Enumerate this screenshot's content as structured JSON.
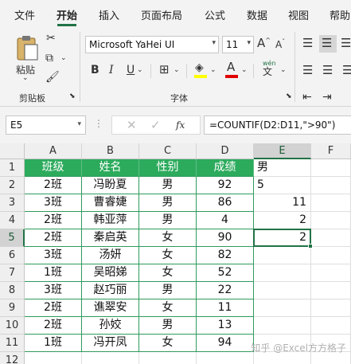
{
  "menu": {
    "tabs": [
      "文件",
      "开始",
      "插入",
      "页面布局",
      "公式",
      "数据",
      "视图",
      "帮助"
    ],
    "active": "开始"
  },
  "ribbon": {
    "clipboard_group": "剪贴板",
    "paste_label": "粘贴",
    "font_group": "字体",
    "font_name": "Microsoft YaHei UI",
    "font_size": "11",
    "bold": "B",
    "italic": "I",
    "underline": "U",
    "grow_font": "A",
    "shrink_font": "A",
    "font_color_letter": "A",
    "phonetic": "wén",
    "phonetic_char": "文",
    "accent_color": "#217346",
    "fill_color": "#ffff00",
    "font_color": "#e00000"
  },
  "formula_bar": {
    "name_box": "E5",
    "fx": "fx",
    "formula": "=COUNTIF(D2:D11,\">90\")"
  },
  "sheet": {
    "columns": [
      "A",
      "B",
      "C",
      "D",
      "E",
      "F"
    ],
    "rows": [
      "1",
      "2",
      "3",
      "4",
      "5",
      "6",
      "7",
      "8",
      "9",
      "10",
      "11",
      "12"
    ],
    "selected_cell": "E5",
    "table": {
      "headers": [
        "班级",
        "姓名",
        "性别",
        "成绩"
      ],
      "rows": [
        [
          "2班",
          "冯盼夏",
          "男",
          "92"
        ],
        [
          "3班",
          "曹睿婕",
          "男",
          "86"
        ],
        [
          "2班",
          "韩亚萍",
          "男",
          "4"
        ],
        [
          "2班",
          "秦启英",
          "女",
          "90"
        ],
        [
          "3班",
          "汤妍",
          "女",
          "82"
        ],
        [
          "1班",
          "吴昭娣",
          "女",
          "52"
        ],
        [
          "3班",
          "赵巧丽",
          "男",
          "22"
        ],
        [
          "2班",
          "谯翠安",
          "女",
          "11"
        ],
        [
          "2班",
          "孙姣",
          "男",
          "13"
        ],
        [
          "1班",
          "冯开凤",
          "女",
          "94"
        ]
      ]
    },
    "column_e": [
      "男",
      "5",
      "11",
      "2",
      "2"
    ]
  },
  "watermark": "知乎 @Excel方方格子"
}
